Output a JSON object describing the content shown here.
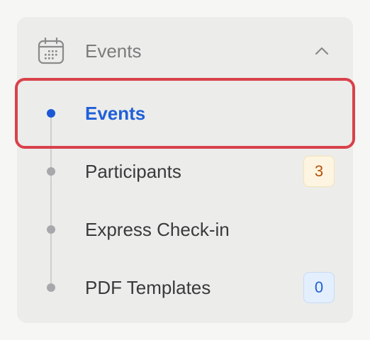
{
  "group": {
    "title": "Events",
    "icon": "calendar-icon",
    "chevron_icon": "chevron-up-icon",
    "expanded": true
  },
  "items": [
    {
      "label": "Events",
      "active": true,
      "badge": null
    },
    {
      "label": "Participants",
      "active": false,
      "badge": "3",
      "badge_style": "warning"
    },
    {
      "label": "Express Check-in",
      "active": false,
      "badge": null
    },
    {
      "label": "PDF Templates",
      "active": false,
      "badge": "0",
      "badge_style": "info"
    }
  ],
  "colors": {
    "accent": "#1f5fd8",
    "highlight": "#d9414a",
    "warning_text": "#b8530b",
    "warning_bg": "#fdf5e1",
    "info_bg": "#e4effd"
  }
}
